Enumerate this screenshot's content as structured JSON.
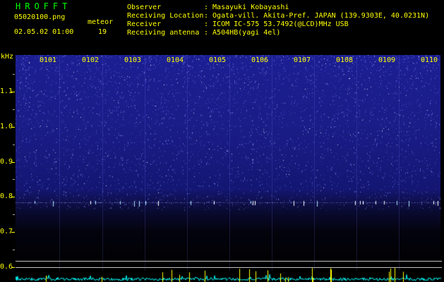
{
  "header": {
    "logo": "HROFFT",
    "filename": "05020100.png",
    "datetime": "02.05.02 01:00",
    "meteor_label": "meteor",
    "meteor_count": "19",
    "rows": [
      {
        "label": "Observer",
        "value": ": Masayuki Kobayashi"
      },
      {
        "label": "Receiving Location",
        "value": ": Ogata-vill. Akita-Pref. JAPAN (139.9303E, 40.0231N)"
      },
      {
        "label": "Receiver",
        "value": ": ICOM IC-575 53.7492(@LCD)MHz USB"
      },
      {
        "label": "Receiving antenna",
        "value": ": A504HB(yagi 4el)"
      }
    ]
  },
  "spectrogram": {
    "unit_label": "kHz",
    "time_labels": [
      "0101",
      "0102",
      "0103",
      "0104",
      "0105",
      "0106",
      "0107",
      "0108",
      "0109",
      "0110"
    ],
    "freq_ticks": [
      "1.1",
      "1.0",
      "0.9",
      "0.8",
      "0.7",
      "0.6"
    ],
    "freq_range": [
      0.58,
      1.2
    ],
    "meteor_echo_freq": 0.775,
    "colors": {
      "signal": "#ffffff",
      "background": "#1b1e92",
      "noise_bottom": "#00ffff",
      "echo_spike": "#ffff00",
      "axis": "#ffff00"
    }
  }
}
